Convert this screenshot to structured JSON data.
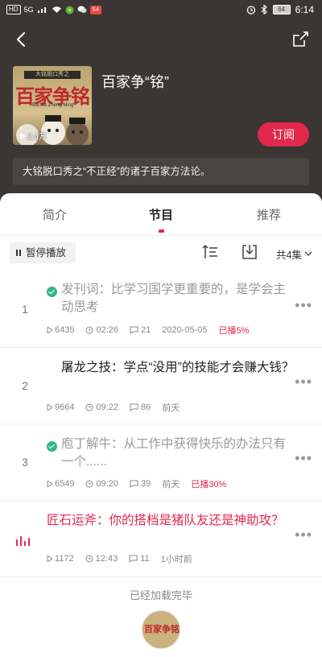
{
  "status_bar": {
    "network_chip": "HD",
    "signal": "5G",
    "app_badge": "S4",
    "battery": "64",
    "time": "6:14"
  },
  "header": {
    "back_icon": "back-arrow-icon",
    "share_icon": "share-icon"
  },
  "album": {
    "title": "百家争“铭”",
    "play_count": "2.4万",
    "subscribe_label": "订阅",
    "description": "大铭脱口秀之“不正经”的诸子百家方法论。",
    "cover_text": "百家争铭",
    "cover_banner": "大铭脱口秀之",
    "cover_subtitle": "Bai Jia Zheng Ming"
  },
  "tabs": [
    {
      "label": "简介",
      "active": false
    },
    {
      "label": "节目",
      "active": true
    },
    {
      "label": "推荐",
      "active": false
    }
  ],
  "toolbar": {
    "pause_label": "暂停播放",
    "episode_total": "共4集"
  },
  "episodes": [
    {
      "index": "1",
      "title": "发刊词：比学习国学更重要的，是学会主动思考",
      "state": "played",
      "plays": "6435",
      "duration": "02:26",
      "comments": "21",
      "date": "2020-05-05",
      "progress": "已播5%"
    },
    {
      "index": "2",
      "title": "屠龙之技：学点“没用”的技能才会赚大钱？",
      "state": "unplayed",
      "plays": "9664",
      "duration": "09:22",
      "comments": "86",
      "date": "前天",
      "progress": ""
    },
    {
      "index": "3",
      "title": "庖丁解牛：从工作中获得快乐的办法只有一个......",
      "state": "played",
      "plays": "6549",
      "duration": "09:20",
      "comments": "39",
      "date": "前天",
      "progress": "已播30%"
    },
    {
      "index": "",
      "title": "匠石运斧：你的搭档是猪队友还是神助攻？",
      "state": "current",
      "plays": "1172",
      "duration": "12:43",
      "comments": "11",
      "date": "1小时前",
      "progress": ""
    }
  ],
  "footer": {
    "loaded_text": "已经加载完毕",
    "mini_cover_text": "百家争铭"
  },
  "colors": {
    "accent": "#e2284b",
    "hero_bg": "#3b3533",
    "played_check": "#2fb68a"
  }
}
